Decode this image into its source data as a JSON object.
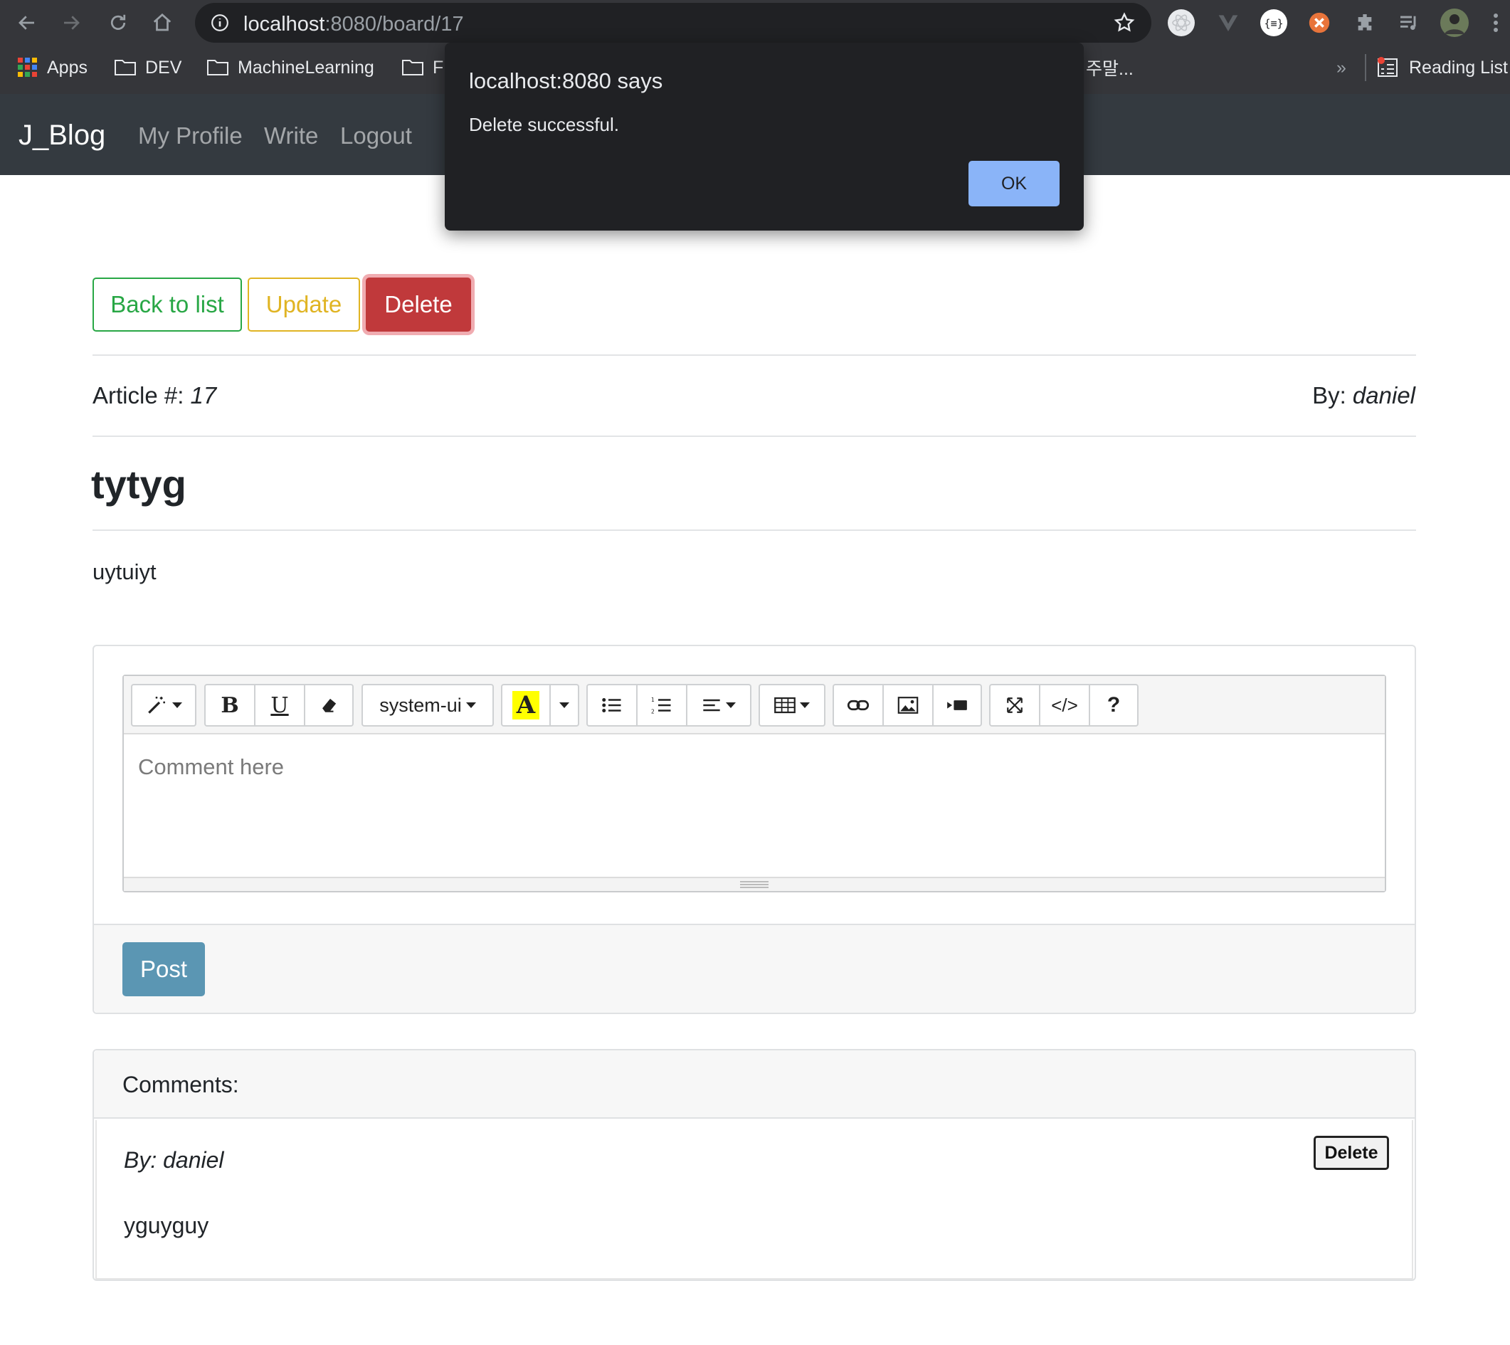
{
  "browser": {
    "url_host": "localhost",
    "url_path": ":8080/board/17",
    "bookmarks": {
      "apps": "Apps",
      "dev": "DEV",
      "ml": "MachineLearning",
      "f": "F",
      "korean": "주말...",
      "overflow": "»",
      "reading_list": "Reading List"
    }
  },
  "navbar": {
    "brand": "J_Blog",
    "links": [
      "My Profile",
      "Write",
      "Logout"
    ]
  },
  "actions": {
    "back": "Back to list",
    "update": "Update",
    "delete": "Delete"
  },
  "article": {
    "number_label": "Article #:",
    "number": "17",
    "author_label": "By:",
    "author": "daniel",
    "title": "tytyg",
    "content": "uytuiyt"
  },
  "editor": {
    "font_name": "system-ui",
    "placeholder": "Comment here",
    "help": "?",
    "code": "</>",
    "bold": "B",
    "underline": "U",
    "color_letter": "A"
  },
  "comment_form": {
    "post_label": "Post"
  },
  "comments": {
    "header": "Comments:",
    "items": [
      {
        "author": "By: daniel",
        "text": "yguyguy",
        "delete_label": "Delete"
      }
    ]
  },
  "alert": {
    "title": "localhost:8080 says",
    "message": "Delete successful.",
    "ok": "OK"
  },
  "colors": {
    "navbar": "#343a40",
    "success": "#28a745",
    "warning": "#e0b423",
    "danger": "#c0393b",
    "post": "#5b96b3",
    "dialog_bg": "#202124",
    "dialog_ok": "#8ab4f8"
  }
}
